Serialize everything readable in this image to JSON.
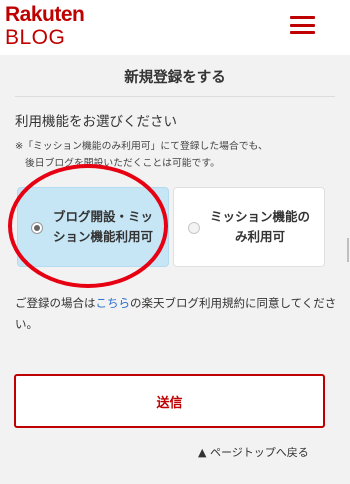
{
  "header": {
    "logo_line1": "Rakuten",
    "logo_line2": "BLOG",
    "menu_icon": "hamburger-menu-icon",
    "brand_color": "#bf0000"
  },
  "page": {
    "title": "新規登録をする",
    "section_heading": "利用機能をお選びください",
    "note_line1": "※「ミッション機能のみ利用可」にて登録した場合でも、",
    "note_line2": "後日ブログを開設いただくことは可能です。"
  },
  "options": [
    {
      "label": "ブログ開設・ミッション機能利用可",
      "selected": true
    },
    {
      "label": "ミッション機能のみ利用可",
      "selected": false
    }
  ],
  "consent": {
    "before": "ご登録の場合は",
    "link": "こちら",
    "after": "の楽天ブログ利用規約に同意してください。"
  },
  "submit_label": "送信",
  "page_top_label": "▲ ページトップへ戻る",
  "colors": {
    "accent": "#bf0000",
    "selected_bg": "#c6e6f6",
    "link": "#2a6fcb",
    "annotation": "#e60012"
  }
}
